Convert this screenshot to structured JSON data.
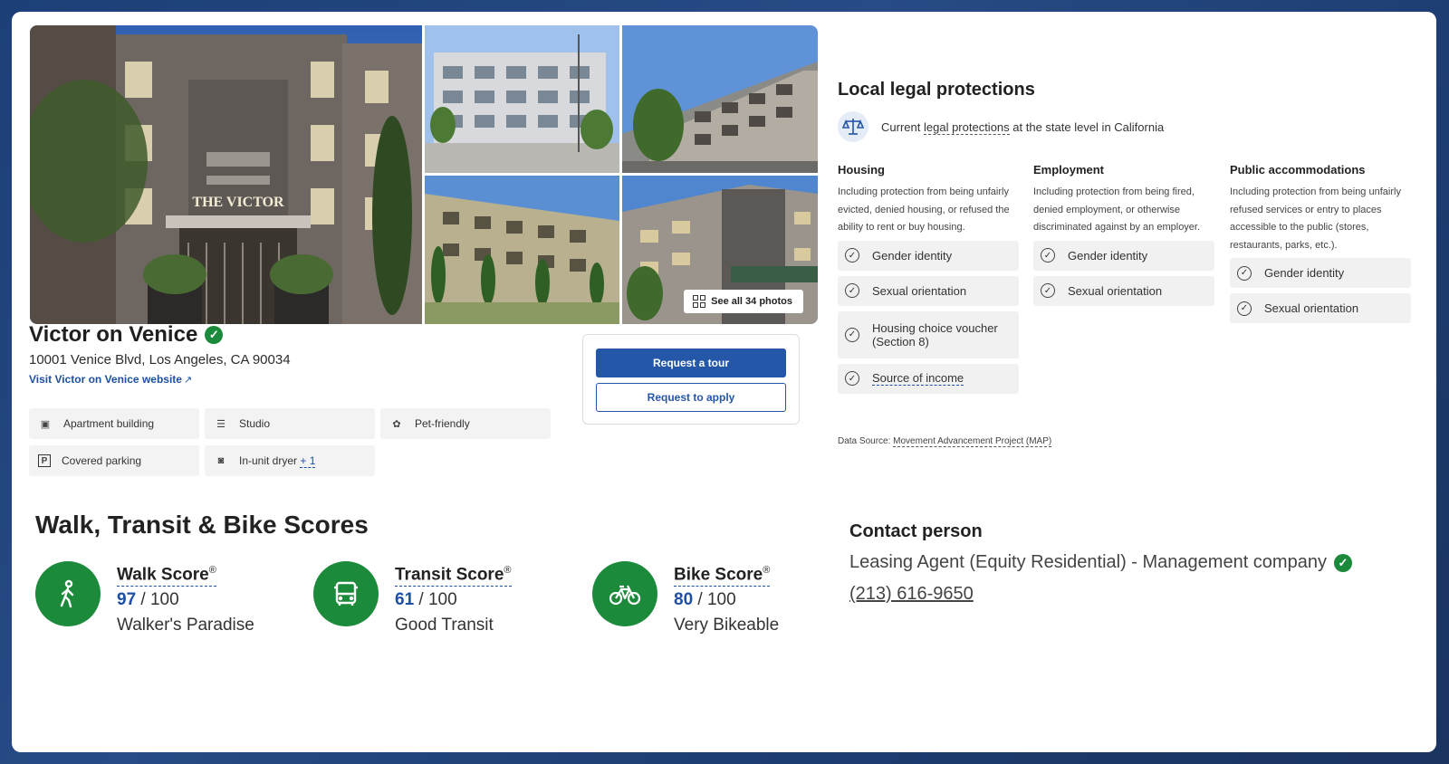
{
  "gallery": {
    "see_all_label": "See all 34 photos",
    "main_sign": "THE VICTOR"
  },
  "listing": {
    "name": "Victor on Venice",
    "address": "10001 Venice Blvd, Los Angeles, CA 90034",
    "website_label": "Visit Victor on Venice website",
    "amenities": [
      {
        "icon": "building-icon",
        "label": "Apartment building"
      },
      {
        "icon": "bed-icon",
        "label": "Studio"
      },
      {
        "icon": "paw-icon",
        "label": "Pet-friendly"
      },
      {
        "icon": "parking-icon",
        "label": "Covered parking"
      },
      {
        "icon": "dryer-icon",
        "label": "In-unit dryer",
        "more": "+ 1"
      }
    ],
    "cta": {
      "primary": "Request a tour",
      "secondary": "Request to apply"
    }
  },
  "legal": {
    "title": "Local legal protections",
    "subtitle_pre": "Current",
    "subtitle_link": "legal protections",
    "subtitle_post": "at the state level in California",
    "columns": [
      {
        "heading": "Housing",
        "description": "Including protection from being unfairly evicted, denied housing, or refused the ability to rent or buy housing.",
        "items": [
          "Gender identity",
          "Sexual orientation",
          "Housing choice voucher (Section 8)",
          "Source of income"
        ]
      },
      {
        "heading": "Employment",
        "description": "Including protection from being fired, denied employment, or otherwise discriminated against by an employer.",
        "items": [
          "Gender identity",
          "Sexual orientation"
        ]
      },
      {
        "heading": "Public accommodations",
        "description": "Including protection from being unfairly refused services or entry to places accessible to the public (stores, restaurants, parks, etc.).",
        "items": [
          "Gender identity",
          "Sexual orientation"
        ]
      }
    ],
    "data_source_label": "Data Source:",
    "data_source_link": "Movement Advancement Project (MAP)"
  },
  "scores": {
    "title": "Walk, Transit & Bike Scores",
    "items": [
      {
        "name": "Walk Score",
        "value": "97",
        "max": "/ 100",
        "desc": "Walker's Paradise",
        "icon": "walking-person-icon"
      },
      {
        "name": "Transit Score",
        "value": "61",
        "max": "/ 100",
        "desc": "Good Transit",
        "icon": "bus-icon"
      },
      {
        "name": "Bike Score",
        "value": "80",
        "max": "/ 100",
        "desc": "Very Bikeable",
        "icon": "bicycle-icon"
      }
    ]
  },
  "contact": {
    "title": "Contact person",
    "name": "Leasing Agent (Equity Residential) - Management company",
    "phone": "(213) 616-9650"
  },
  "colors": {
    "brand_blue": "#2457a8",
    "verified_green": "#1b8a3a",
    "link_blue": "#1d4fa3"
  }
}
